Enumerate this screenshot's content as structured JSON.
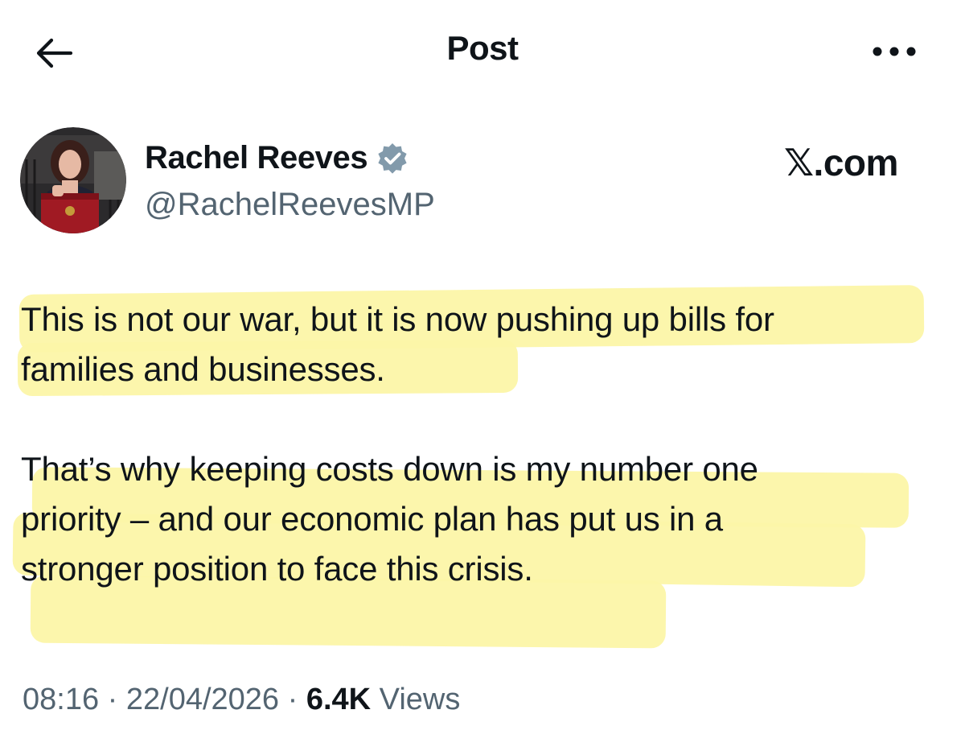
{
  "header": {
    "title": "Post",
    "back_icon": "arrow-left-icon",
    "more_icon": "more-horizontal-icon"
  },
  "author": {
    "name": "Rachel Reeves",
    "handle": "@RachelReevesMP",
    "verified": true,
    "verified_color": "#829aab"
  },
  "watermark": "𝕏.com",
  "post": {
    "paragraphs": [
      {
        "lines": [
          "This is not our war, but it is now pushing up bills for",
          "families and businesses."
        ]
      },
      {
        "lines": [
          "That’s why keeping costs down is my number one",
          "priority – and our economic plan has put us in a",
          "stronger position to face this crisis."
        ]
      }
    ],
    "highlight_color": "#fcf6a8"
  },
  "meta": {
    "time": "08:16",
    "separator": " · ",
    "date": "22/04/2026",
    "views_count": "6.4K",
    "views_label": " Views"
  }
}
